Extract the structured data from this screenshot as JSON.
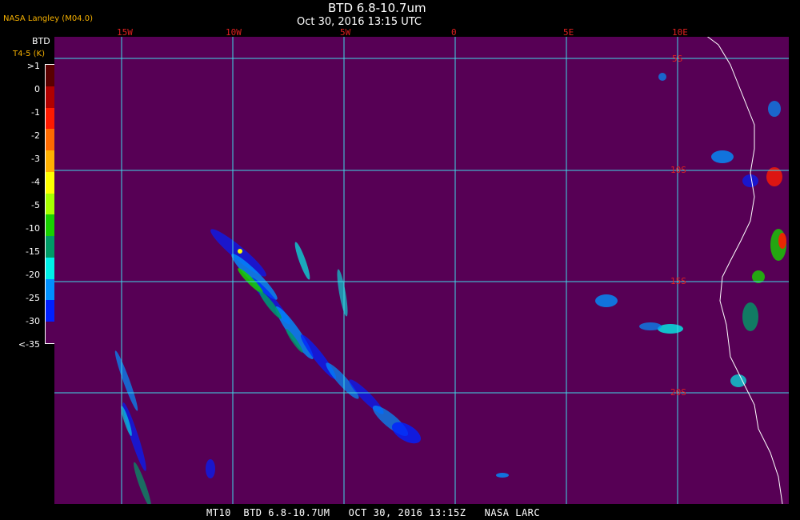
{
  "source_tag": "NASA Langley (M04.0)",
  "title": "BTD 6.8-10.7um",
  "subtitle": "Oct 30, 2016 13:15 UTC",
  "legend": {
    "label": "BTD",
    "unit": "T4-5 (K)",
    "ticks": [
      ">1",
      "0",
      "-1",
      "-2",
      "-3",
      "-4",
      "-5",
      "-10",
      "-15",
      "-20",
      "-25",
      "-30",
      "<-35"
    ],
    "colors": [
      "#5a0000",
      "#b00000",
      "#ff1a00",
      "#ff6a00",
      "#ffb000",
      "#ffff00",
      "#a6ff00",
      "#18d000",
      "#009a66",
      "#00f0e8",
      "#0090ff",
      "#0020ff",
      "#570055"
    ]
  },
  "map": {
    "background_color": "#570055",
    "grid_color": "#3fd8e8",
    "label_color": "#e02020",
    "coast_color": "#ffffff",
    "longitude_labels": [
      "15W",
      "10W",
      "5W",
      "0",
      "5E",
      "10E"
    ],
    "latitude_labels": [
      "5S",
      "10S",
      "15S",
      "20S"
    ]
  },
  "footer": "MT10  BTD 6.8-10.7UM   OCT 30, 2016 13:15Z   NASA LARC"
}
